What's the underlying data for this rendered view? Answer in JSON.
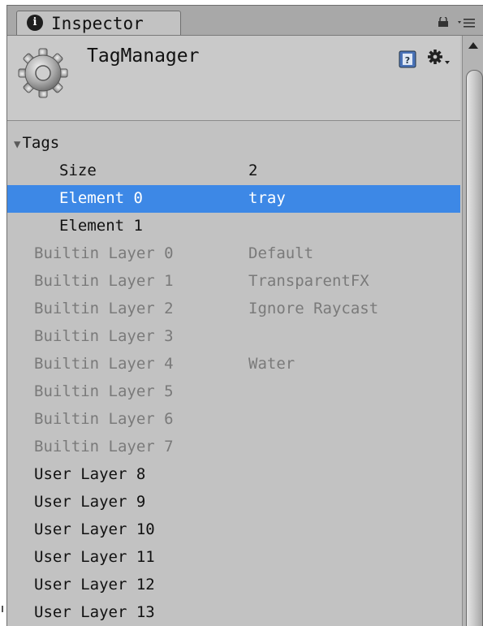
{
  "tab": {
    "icon": "info-icon",
    "label": "Inspector"
  },
  "header": {
    "object_name": "TagManager",
    "icon": "gear-icon"
  },
  "tags": {
    "label": "Tags",
    "size_label": "Size",
    "size_value": "2",
    "elements": [
      {
        "label": "Element 0",
        "value": "tray"
      },
      {
        "label": "Element 1",
        "value": ""
      }
    ]
  },
  "builtin_layers": [
    {
      "label": "Builtin Layer 0",
      "value": "Default"
    },
    {
      "label": "Builtin Layer 1",
      "value": "TransparentFX"
    },
    {
      "label": "Builtin Layer 2",
      "value": "Ignore Raycast"
    },
    {
      "label": "Builtin Layer 3",
      "value": ""
    },
    {
      "label": "Builtin Layer 4",
      "value": "Water"
    },
    {
      "label": "Builtin Layer 5",
      "value": ""
    },
    {
      "label": "Builtin Layer 6",
      "value": ""
    },
    {
      "label": "Builtin Layer 7",
      "value": ""
    }
  ],
  "user_layers": [
    {
      "label": "User Layer 8",
      "value": ""
    },
    {
      "label": "User Layer 9",
      "value": ""
    },
    {
      "label": "User Layer 10",
      "value": ""
    },
    {
      "label": "User Layer 11",
      "value": ""
    },
    {
      "label": "User Layer 12",
      "value": ""
    },
    {
      "label": "User Layer 13",
      "value": ""
    }
  ],
  "colors": {
    "selection": "#3d88e6",
    "panel": "#c2c2c2",
    "disabled_text": "#7a7a7a"
  }
}
